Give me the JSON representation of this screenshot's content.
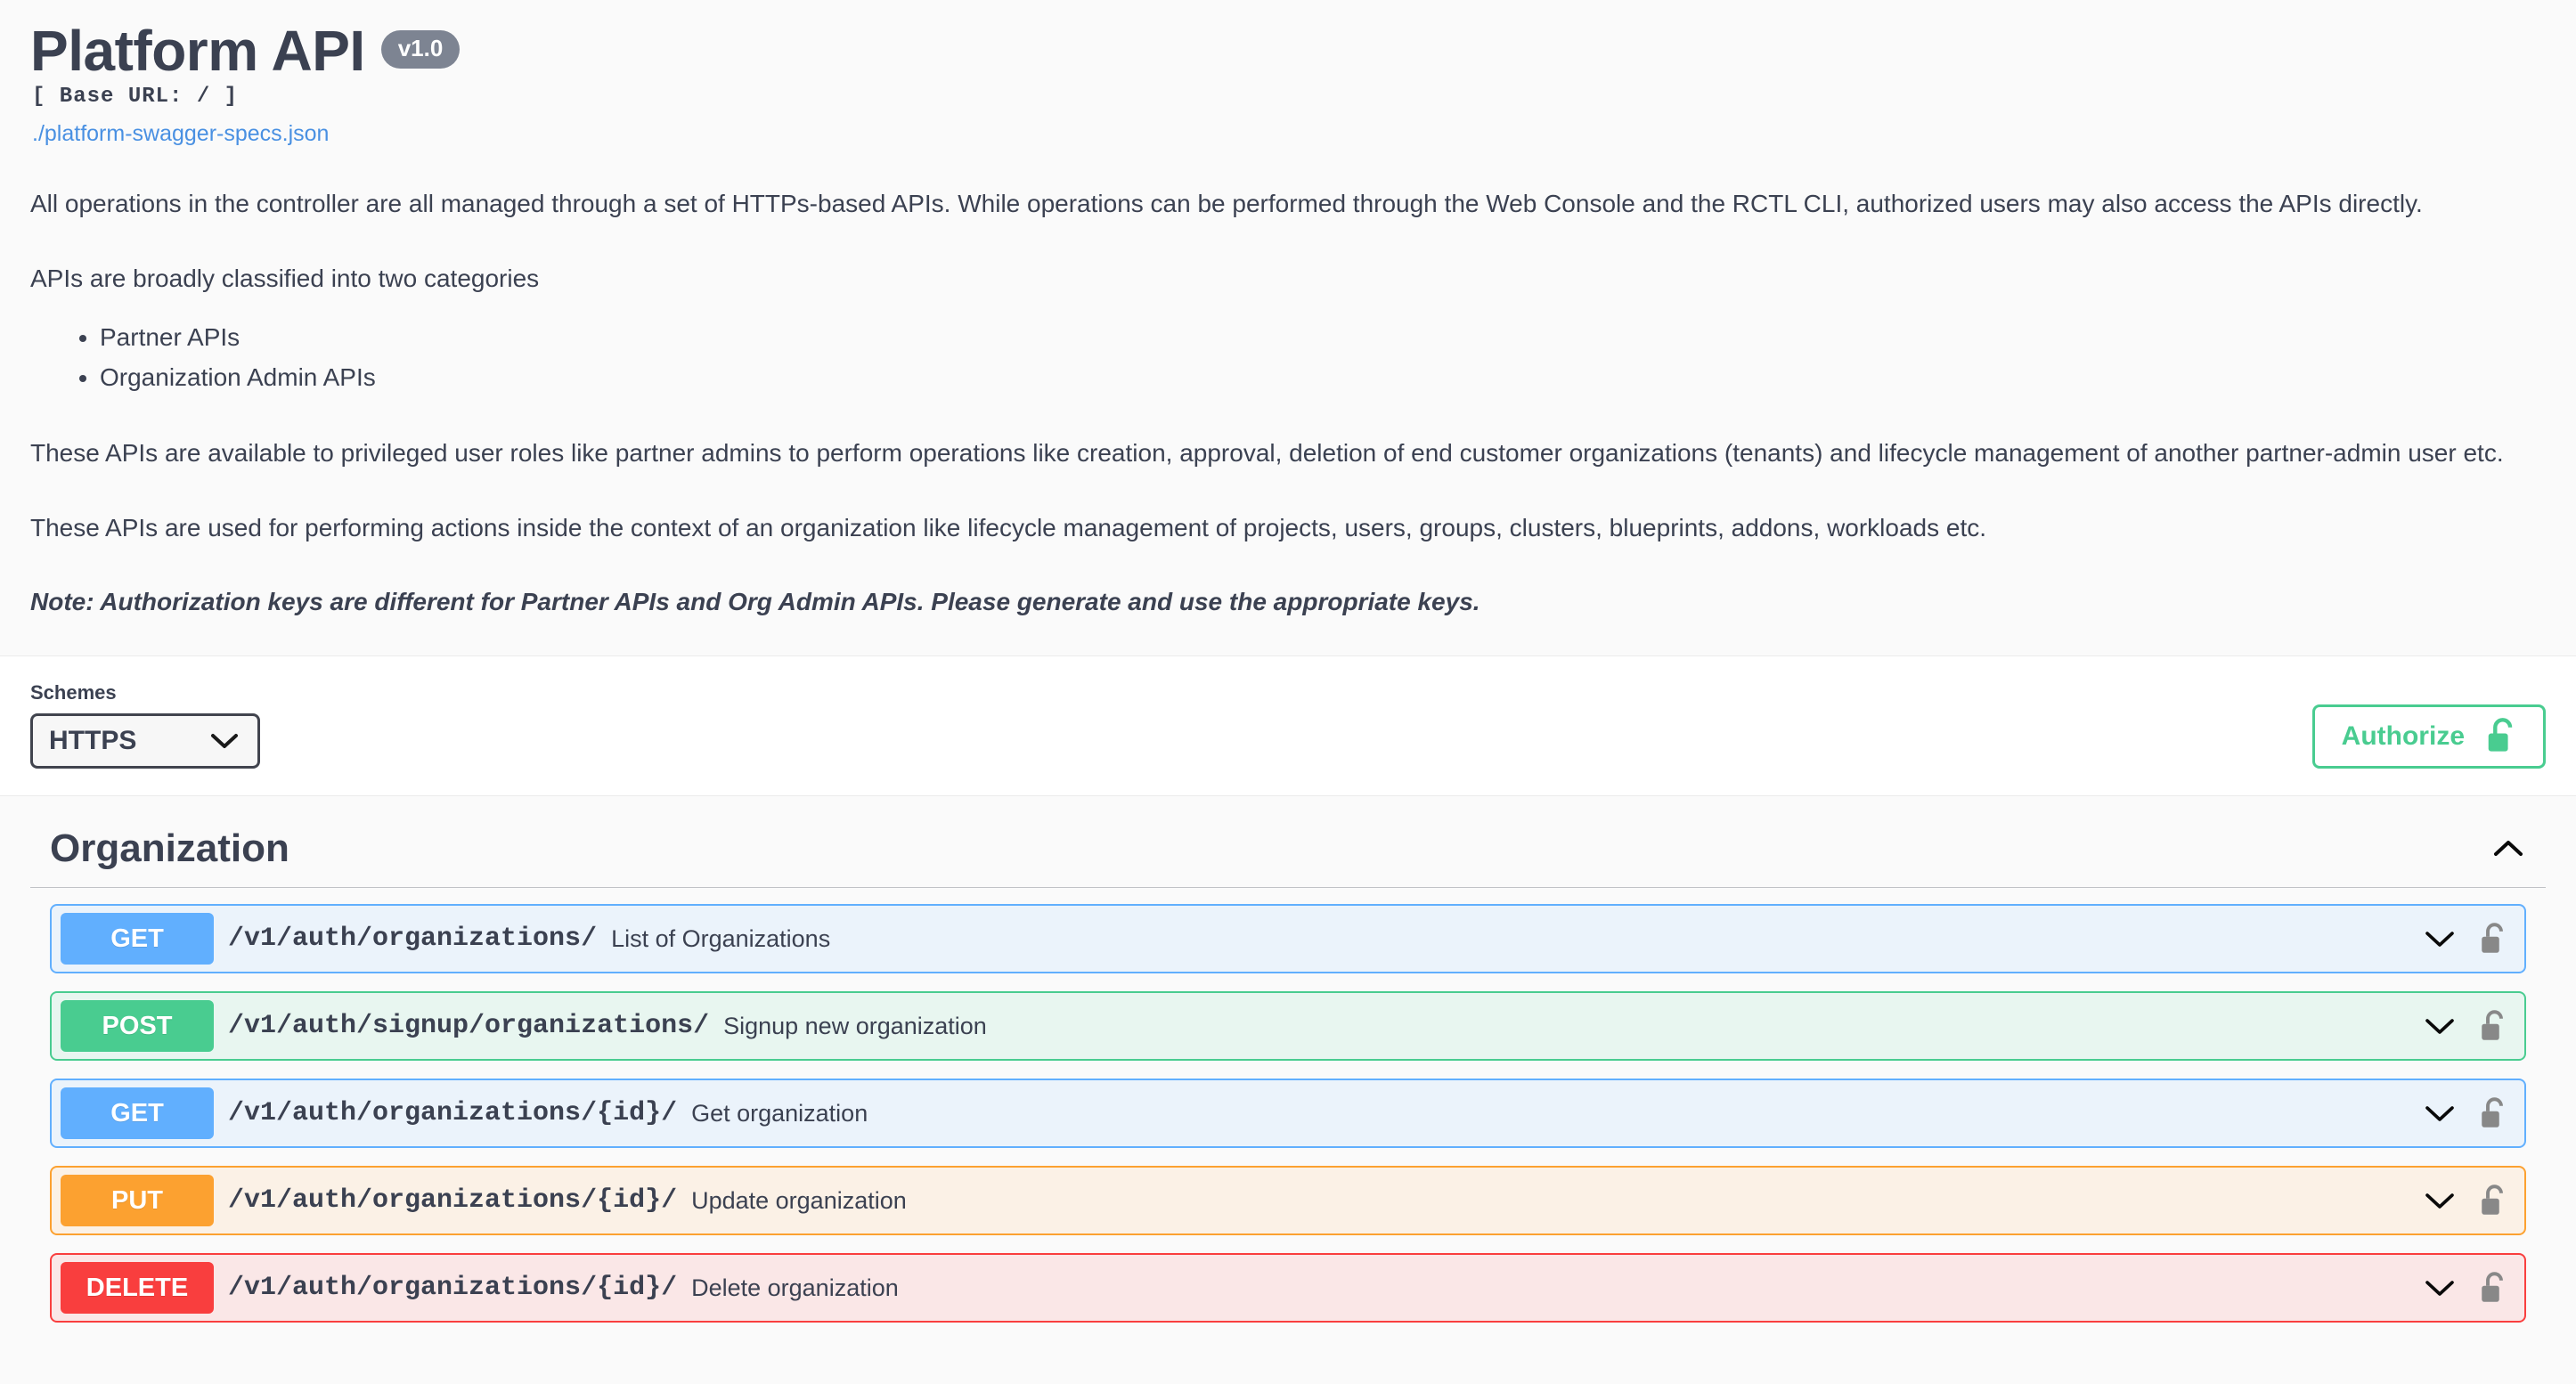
{
  "header": {
    "title": "Platform API",
    "version_badge": "v1.0",
    "base_url": "[ Base URL: / ]",
    "spec_link": "./platform-swagger-specs.json"
  },
  "description": {
    "paragraph_1": "All operations in the controller are all managed through a set of HTTPs-based APIs. While operations can be performed through the Web Console and the RCTL CLI, authorized users may also access the APIs directly.",
    "paragraph_2": "APIs are broadly classified into two categories",
    "categories": [
      "Partner APIs",
      "Organization Admin APIs"
    ],
    "paragraph_3": "These APIs are available to privileged user roles like partner admins to perform operations like creation, approval, deletion of end customer organizations (tenants) and lifecycle management of another partner-admin user etc.",
    "paragraph_4": "These APIs are used for performing actions inside the context of an organization like lifecycle management of projects, users, groups, clusters, blueprints, addons, workloads etc.",
    "note": "Note: Authorization keys are different for Partner APIs and Org Admin APIs. Please generate and use the appropriate keys."
  },
  "schemes": {
    "label": "Schemes",
    "selected": "HTTPS",
    "options": [
      "HTTPS"
    ],
    "chevron_icon": "chevron-down-icon"
  },
  "authorize": {
    "label": "Authorize",
    "lock_icon": "unlocked-padlock-icon",
    "accent_color": "#49cc90"
  },
  "tag_section": {
    "name": "Organization",
    "toggle_icon": "chevron-up-icon",
    "expanded": true,
    "operations": [
      {
        "method": "GET",
        "method_color": "#61affe",
        "block_bg": "#ebf3fb",
        "path": "/v1/auth/organizations/",
        "summary": "List of Organizations",
        "arrow_icon": "chevron-down-icon",
        "lock_icon": "unlocked-padlock-icon"
      },
      {
        "method": "POST",
        "method_color": "#49cc90",
        "block_bg": "#e8f6f0",
        "path": "/v1/auth/signup/organizations/",
        "summary": "Signup new organization",
        "arrow_icon": "chevron-down-icon",
        "lock_icon": "unlocked-padlock-icon"
      },
      {
        "method": "GET",
        "method_color": "#61affe",
        "block_bg": "#ebf3fb",
        "path": "/v1/auth/organizations/{id}/",
        "summary": "Get organization",
        "arrow_icon": "chevron-down-icon",
        "lock_icon": "unlocked-padlock-icon"
      },
      {
        "method": "PUT",
        "method_color": "#fca130",
        "block_bg": "#fbf1e6",
        "path": "/v1/auth/organizations/{id}/",
        "summary": "Update organization",
        "arrow_icon": "chevron-down-icon",
        "lock_icon": "unlocked-padlock-icon"
      },
      {
        "method": "DELETE",
        "method_color": "#f93e3e",
        "block_bg": "#fae7e7",
        "path": "/v1/auth/organizations/{id}/",
        "summary": "Delete organization",
        "arrow_icon": "chevron-down-icon",
        "lock_icon": "unlocked-padlock-icon"
      }
    ]
  }
}
